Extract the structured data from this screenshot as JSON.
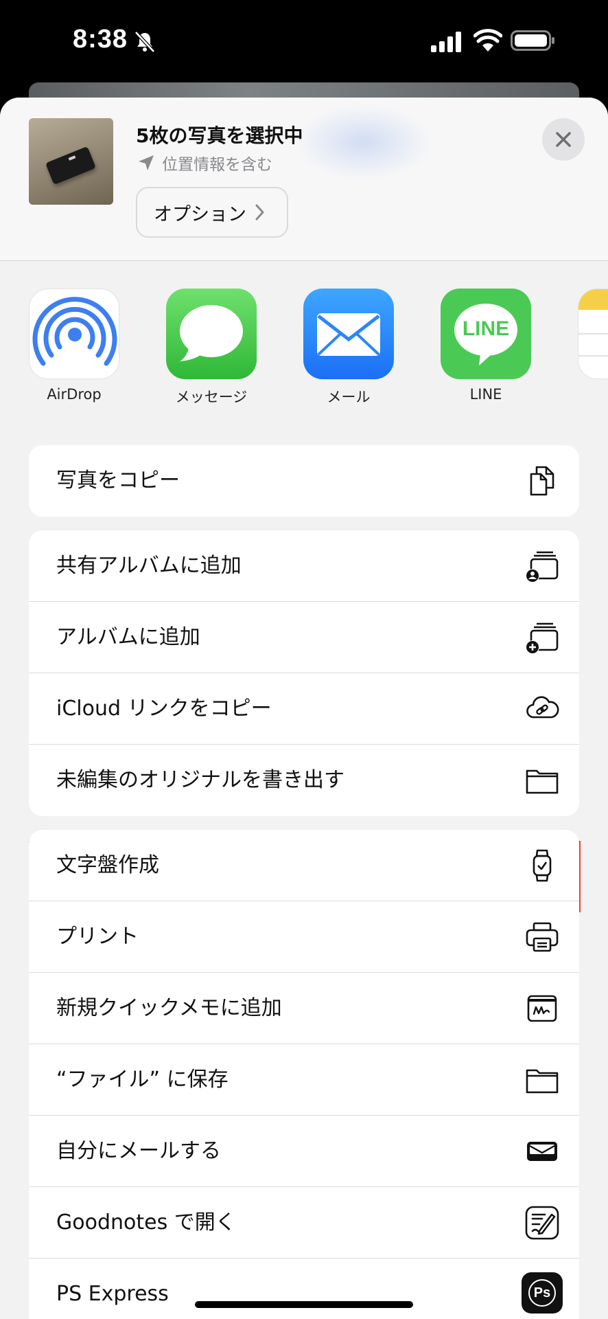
{
  "status_bar": {
    "time": "8:38"
  },
  "share_sheet": {
    "title": "5枚の写真を選択中",
    "subtitle": "位置情報を含む",
    "options_label": "オプション",
    "apps": [
      {
        "name": "AirDrop",
        "icon": "airdrop-icon"
      },
      {
        "name": "メッセージ",
        "icon": "messages-icon"
      },
      {
        "name": "メール",
        "icon": "mail-icon"
      },
      {
        "name": "LINE",
        "icon": "line-icon"
      },
      {
        "name": "",
        "icon": "notes-icon"
      }
    ],
    "line_logo_text": "LINE",
    "groups": [
      [
        {
          "label": "写真をコピー",
          "icon": "copy-icon"
        }
      ],
      [
        {
          "label": "共有アルバムに追加",
          "icon": "shared-album-icon"
        },
        {
          "label": "アルバムに追加",
          "icon": "add-album-icon"
        },
        {
          "label": "iCloud リンクをコピー",
          "icon": "icloud-link-icon"
        },
        {
          "label": "未編集のオリジナルを書き出す",
          "icon": "folder-icon"
        }
      ],
      [
        {
          "label": "文字盤作成",
          "icon": "watch-icon"
        },
        {
          "label": "プリント",
          "icon": "printer-icon"
        },
        {
          "label": "新規クイックメモに追加",
          "icon": "quick-note-icon"
        },
        {
          "label": "“ファイル” に保存",
          "icon": "folder-icon"
        },
        {
          "label": "自分にメールする",
          "icon": "mail-self-icon"
        },
        {
          "label": "Goodnotes で開く",
          "icon": "goodnotes-icon"
        },
        {
          "label": "PS Express",
          "icon": "ps-express-icon"
        }
      ]
    ],
    "ps_logo_text": "Ps",
    "highlight_color": "#e8432a"
  }
}
